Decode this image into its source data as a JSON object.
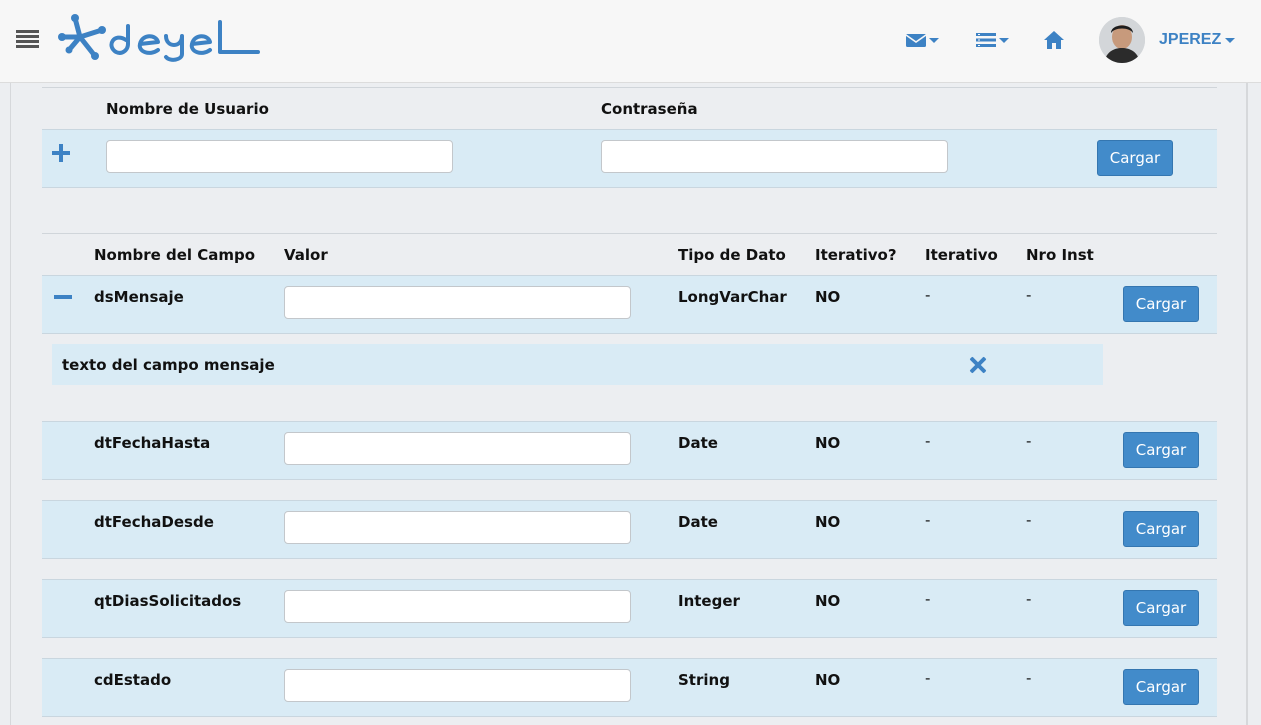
{
  "header": {
    "logo_text": "deyel",
    "username": "JPEREZ",
    "icons": [
      "menu-icon",
      "mail-icon",
      "list-icon",
      "home-icon",
      "avatar"
    ]
  },
  "login": {
    "username_label": "Nombre de Usuario",
    "password_label": "Contraseña",
    "username_value": "",
    "password_value": "",
    "load_label": "Cargar"
  },
  "fields": {
    "headers": {
      "name": "Nombre del Campo",
      "value": "Valor",
      "type": "Tipo de Dato",
      "iterative_q": "Iterativo?",
      "iterative": "Iterativo",
      "nro_inst": "Nro Inst"
    },
    "rows": [
      {
        "name": "dsMensaje",
        "value": "",
        "type": "LongVarChar",
        "iterative_q": "NO",
        "iterative": "-",
        "nro_inst": "-",
        "button": "Cargar"
      },
      {
        "name": "dtFechaHasta",
        "value": "",
        "type": "Date",
        "iterative_q": "NO",
        "iterative": "-",
        "nro_inst": "-",
        "button": "Cargar"
      },
      {
        "name": "dtFechaDesde",
        "value": "",
        "type": "Date",
        "iterative_q": "NO",
        "iterative": "-",
        "nro_inst": "-",
        "button": "Cargar"
      },
      {
        "name": "qtDiasSolicitados",
        "value": "",
        "type": "Integer",
        "iterative_q": "NO",
        "iterative": "-",
        "nro_inst": "-",
        "button": "Cargar"
      },
      {
        "name": "cdEstado",
        "value": "",
        "type": "String",
        "iterative_q": "NO",
        "iterative": "-",
        "nro_inst": "-",
        "button": "Cargar"
      }
    ],
    "description": "texto del campo mensaje"
  },
  "colors": {
    "accent": "#428bca",
    "row_bg": "#d9ebf5",
    "page_bg": "#eceef1"
  }
}
